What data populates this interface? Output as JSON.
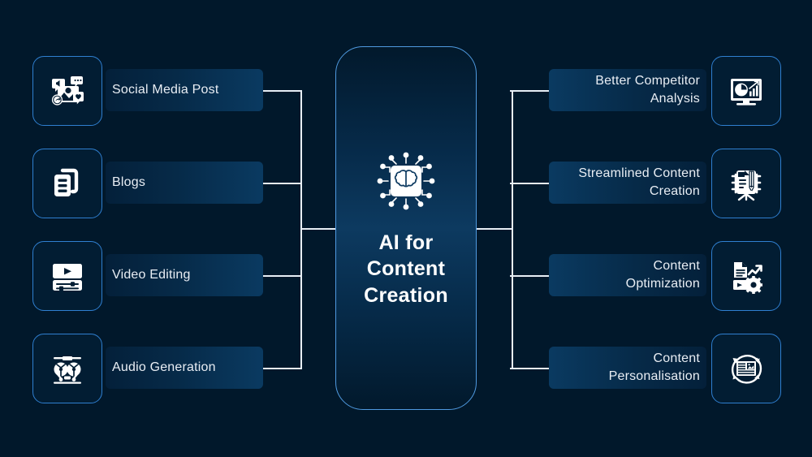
{
  "diagram": {
    "title": "AI for Content Creation",
    "background_color": "#01182b",
    "accent_border_color": "#2f7fd0",
    "center_border_color": "#4f9ae0",
    "label_text_color": "#e9eef4",
    "connector_color": "#e8eef5"
  },
  "center": {
    "label": "AI for\nContent\nCreation",
    "icon": "ai-chip-brain-icon"
  },
  "inputs": [
    {
      "label": "Social Media Post",
      "icon": "social-media-post-icon"
    },
    {
      "label": "Blogs",
      "icon": "blogs-documents-icon"
    },
    {
      "label": "Video Editing",
      "icon": "video-editing-icon"
    },
    {
      "label": "Audio Generation",
      "icon": "audio-generation-reel-icon"
    }
  ],
  "outputs": [
    {
      "label": "Better Competitor\nAnalysis",
      "icon": "competitor-analysis-monitor-icon"
    },
    {
      "label": "Streamlined Content\nCreation",
      "icon": "content-creation-easel-icon"
    },
    {
      "label": "Content\nOptimization",
      "icon": "content-optimization-gear-icon"
    },
    {
      "label": "Content\nPersonalisation",
      "icon": "content-personalisation-refresh-icon"
    }
  ]
}
